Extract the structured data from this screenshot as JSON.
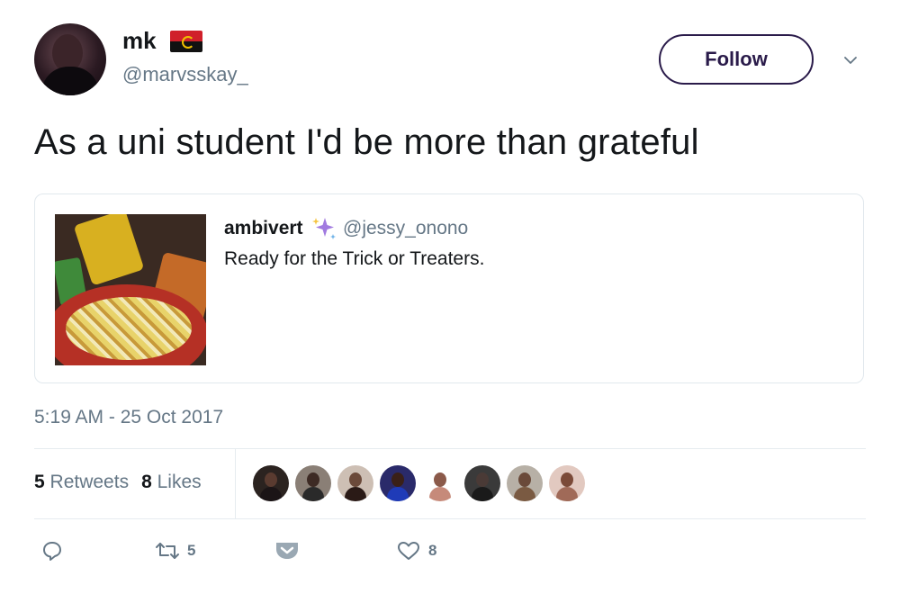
{
  "tweet": {
    "author": {
      "name": "mk",
      "handle": "@marvsskay_",
      "flag": "angola-flag"
    },
    "follow_label": "Follow",
    "text": "As a uni student I'd be more than grateful",
    "timestamp": "5:19 AM - 25 Oct 2017"
  },
  "quoted_tweet": {
    "name": "ambivert",
    "badge": "sparkles-icon",
    "handle": "@jessy_onono",
    "text": "Ready for the Trick or Treaters."
  },
  "stats": {
    "retweets_count": "5",
    "retweets_label": "Retweets",
    "likes_count": "8",
    "likes_label": "Likes"
  },
  "likers": [
    {
      "head": "#5a3b30",
      "torso": "#1b1416",
      "bg": "#2b2320"
    },
    {
      "head": "#3d2a24",
      "torso": "#2a2a2a",
      "bg": "#8a7f76"
    },
    {
      "head": "#6b4a3a",
      "torso": "#2a1a16",
      "bg": "#cdbfb4"
    },
    {
      "head": "#3a2018",
      "torso": "#1f3bb8",
      "bg": "#2a2a6a"
    },
    {
      "head": "#8b5a4a",
      "torso": "#c68a7a",
      "bg": "#ffffff"
    },
    {
      "head": "#4a3a36",
      "torso": "#1a1a1a",
      "bg": "#3a3a3a"
    },
    {
      "head": "#6a4a3a",
      "torso": "#7a5a42",
      "bg": "#b7b0a6"
    },
    {
      "head": "#7b4a38",
      "torso": "#a06a58",
      "bg": "#e2c9c0"
    }
  ],
  "actions": {
    "reply_icon": "reply-icon",
    "retweet_icon": "retweet-icon",
    "retweet_count": "5",
    "pocket_icon": "pocket-icon",
    "like_icon": "heart-icon",
    "like_count": "8"
  },
  "colors": {
    "text": "#14171a",
    "muted": "#657786",
    "follow_border": "#2a1b4a",
    "divider": "#e6ecf0"
  }
}
